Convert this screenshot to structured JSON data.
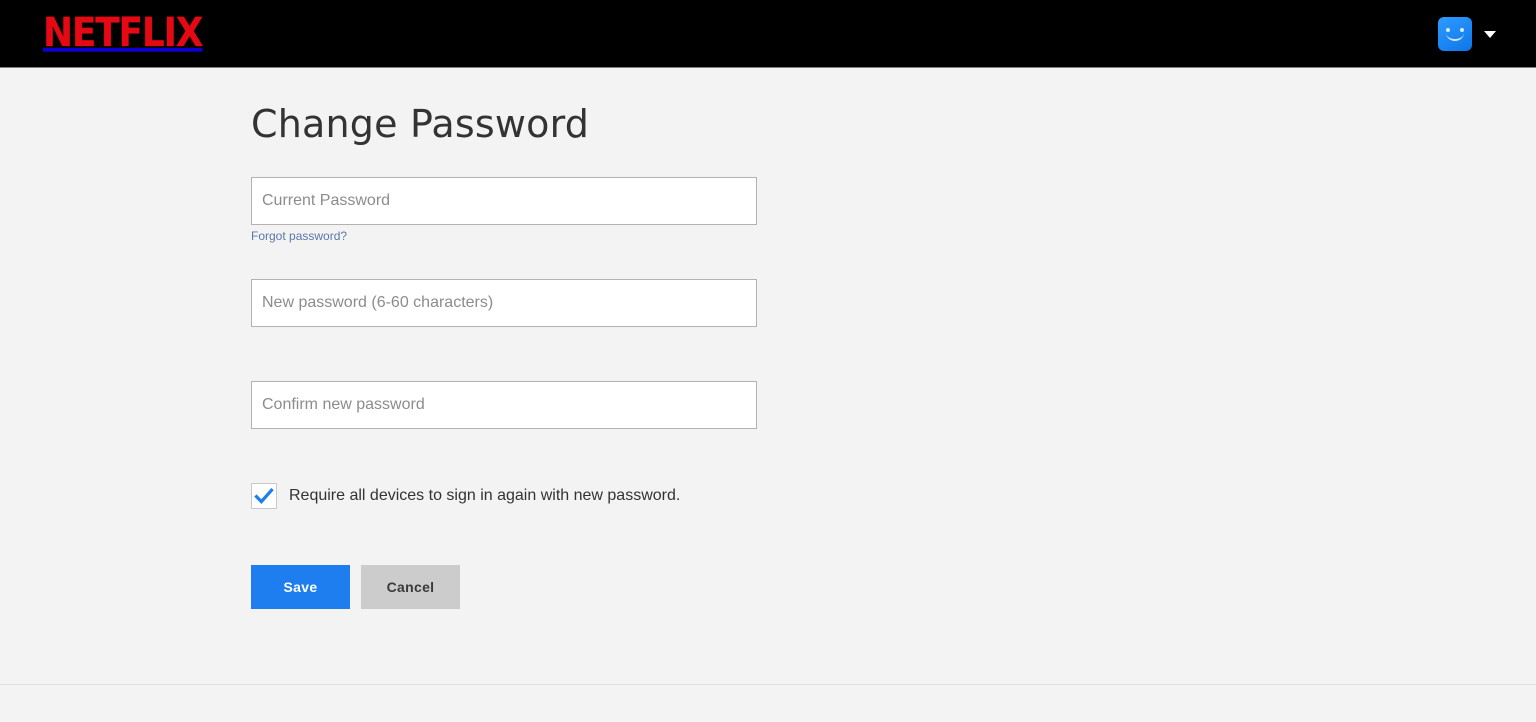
{
  "header": {
    "brand": "NETFLIX",
    "brand_color": "#e50914",
    "background_color": "#000000",
    "account": {
      "avatar_icon": "profile-avatar-smiley-icon",
      "avatar_color": "#1e88ff",
      "caret_icon": "chevron-down-icon"
    }
  },
  "page": {
    "title": "Change Password",
    "background_color": "#f3f3f3",
    "text_color": "#333333"
  },
  "form": {
    "current_password": {
      "placeholder": "Current Password",
      "value": ""
    },
    "forgot_link": {
      "label": "Forgot password?",
      "color": "#5a78a8"
    },
    "new_password": {
      "placeholder": "New password (6-60 characters)",
      "value": ""
    },
    "confirm_password": {
      "placeholder": "Confirm new password",
      "value": ""
    },
    "require_signin": {
      "label": "Require all devices to sign in again with new password.",
      "checked": true,
      "check_color": "#1e7ef0"
    }
  },
  "actions": {
    "save_label": "Save",
    "save_color": "#1e7ef0",
    "cancel_label": "Cancel",
    "cancel_color": "#cccccc"
  }
}
